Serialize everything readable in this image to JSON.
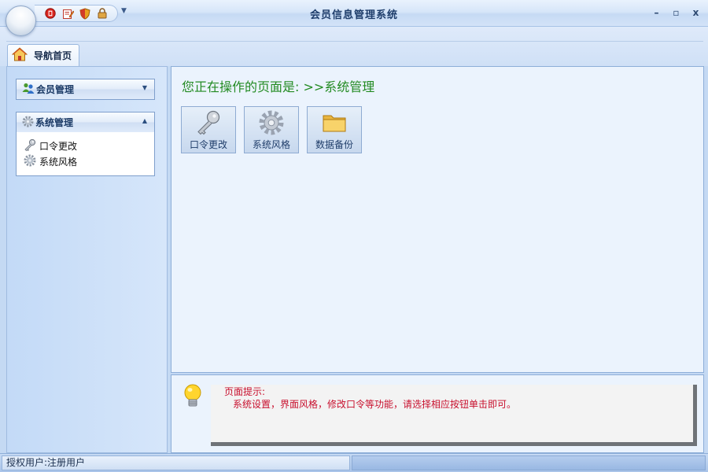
{
  "app": {
    "title": "会员信息管理系统"
  },
  "window_controls": {
    "minimize": "–",
    "maximize": "▫",
    "close": "x"
  },
  "quick_access": [
    "stop",
    "edit",
    "shield",
    "lock"
  ],
  "ribbon": {
    "tab_label": "导航首页"
  },
  "sidebar": {
    "groups": [
      {
        "label": "会员管理",
        "expanded": false,
        "items": []
      },
      {
        "label": "系统管理",
        "expanded": true,
        "items": [
          {
            "label": "口令更改",
            "icon": "key-icon"
          },
          {
            "label": "系统风格",
            "icon": "gear-icon"
          }
        ]
      }
    ]
  },
  "main": {
    "breadcrumb_prefix": "您正在操作的页面是: ",
    "breadcrumb_path": ">>系统管理",
    "tiles": [
      {
        "label": "口令更改",
        "icon": "key-icon"
      },
      {
        "label": "系统风格",
        "icon": "gear-icon"
      },
      {
        "label": "数据备份",
        "icon": "folder-icon"
      }
    ]
  },
  "hint": {
    "title": "页面提示:",
    "text": "系统设置，界面风格，修改口令等功能，请选择相应按钮单击即可。"
  },
  "status": {
    "user": "授权用户:注册用户"
  },
  "colors": {
    "accent": "#238b22",
    "hint_text": "#c8102e",
    "frame": "#c4d9f3"
  }
}
